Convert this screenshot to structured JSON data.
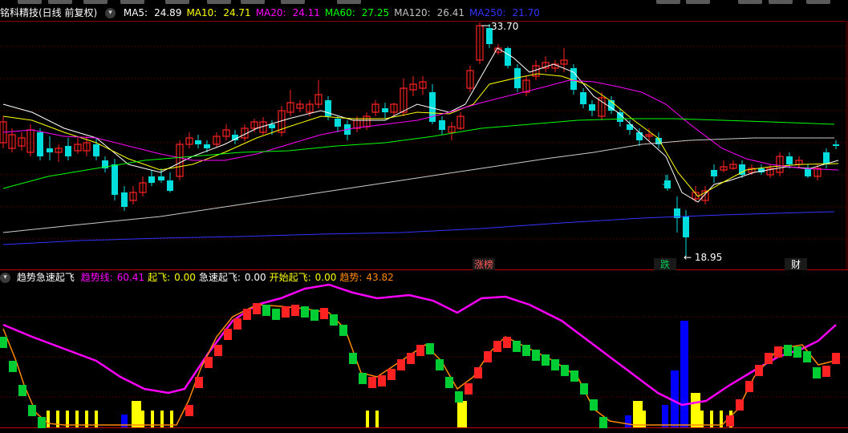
{
  "window": {
    "top_tabs_count": 9
  },
  "main_header": {
    "title": "铭科精技(日线 前复权)",
    "ma": [
      {
        "label": "MA5:",
        "value": "24.89",
        "color": "#ffffff"
      },
      {
        "label": "MA10:",
        "value": "24.71",
        "color": "#ffff00"
      },
      {
        "label": "MA20:",
        "value": "24.11",
        "color": "#ff00ff"
      },
      {
        "label": "MA60:",
        "value": "27.25",
        "color": "#00ff00"
      },
      {
        "label": "MA120:",
        "value": "26.41",
        "color": "#c0c0c0"
      },
      {
        "label": "MA250:",
        "value": "21.70",
        "color": "#3333ff"
      }
    ]
  },
  "price_annotations": {
    "high": "33.70",
    "low": "← 18.95"
  },
  "event_markers": [
    {
      "label": "涨榜",
      "color": "#ff5a5a"
    },
    {
      "label": "跌",
      "color": "#00cc55"
    },
    {
      "label": "财",
      "color": "#ffffff"
    }
  ],
  "indicator_header": {
    "title": "趋势急速起飞",
    "items": [
      {
        "label": "趋势线:",
        "value": "60.41",
        "color": "#ff00ff"
      },
      {
        "label": "起飞:",
        "value": "0.00",
        "color": "#ffff00"
      },
      {
        "label": "急速起飞:",
        "value": "0.00",
        "color": "#ffffff"
      },
      {
        "label": "开始起飞:",
        "value": "0.00",
        "color": "#ffff00"
      },
      {
        "label": "趋势:",
        "value": "43.82",
        "color": "#ff8800"
      }
    ]
  },
  "colors": {
    "up": "#ff2222",
    "down": "#00dddd",
    "divider": "#8b0000"
  }
}
